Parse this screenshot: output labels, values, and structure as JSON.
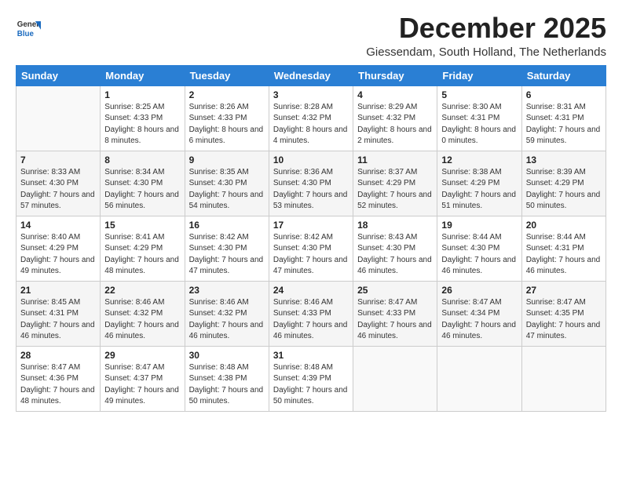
{
  "logo": {
    "general": "General",
    "blue": "Blue"
  },
  "title": "December 2025",
  "subtitle": "Giessendam, South Holland, The Netherlands",
  "header": {
    "days": [
      "Sunday",
      "Monday",
      "Tuesday",
      "Wednesday",
      "Thursday",
      "Friday",
      "Saturday"
    ]
  },
  "weeks": [
    [
      {
        "day": "",
        "info": ""
      },
      {
        "day": "1",
        "info": "Sunrise: 8:25 AM\nSunset: 4:33 PM\nDaylight: 8 hours\nand 8 minutes."
      },
      {
        "day": "2",
        "info": "Sunrise: 8:26 AM\nSunset: 4:33 PM\nDaylight: 8 hours\nand 6 minutes."
      },
      {
        "day": "3",
        "info": "Sunrise: 8:28 AM\nSunset: 4:32 PM\nDaylight: 8 hours\nand 4 minutes."
      },
      {
        "day": "4",
        "info": "Sunrise: 8:29 AM\nSunset: 4:32 PM\nDaylight: 8 hours\nand 2 minutes."
      },
      {
        "day": "5",
        "info": "Sunrise: 8:30 AM\nSunset: 4:31 PM\nDaylight: 8 hours\nand 0 minutes."
      },
      {
        "day": "6",
        "info": "Sunrise: 8:31 AM\nSunset: 4:31 PM\nDaylight: 7 hours\nand 59 minutes."
      }
    ],
    [
      {
        "day": "7",
        "info": "Sunrise: 8:33 AM\nSunset: 4:30 PM\nDaylight: 7 hours\nand 57 minutes."
      },
      {
        "day": "8",
        "info": "Sunrise: 8:34 AM\nSunset: 4:30 PM\nDaylight: 7 hours\nand 56 minutes."
      },
      {
        "day": "9",
        "info": "Sunrise: 8:35 AM\nSunset: 4:30 PM\nDaylight: 7 hours\nand 54 minutes."
      },
      {
        "day": "10",
        "info": "Sunrise: 8:36 AM\nSunset: 4:30 PM\nDaylight: 7 hours\nand 53 minutes."
      },
      {
        "day": "11",
        "info": "Sunrise: 8:37 AM\nSunset: 4:29 PM\nDaylight: 7 hours\nand 52 minutes."
      },
      {
        "day": "12",
        "info": "Sunrise: 8:38 AM\nSunset: 4:29 PM\nDaylight: 7 hours\nand 51 minutes."
      },
      {
        "day": "13",
        "info": "Sunrise: 8:39 AM\nSunset: 4:29 PM\nDaylight: 7 hours\nand 50 minutes."
      }
    ],
    [
      {
        "day": "14",
        "info": "Sunrise: 8:40 AM\nSunset: 4:29 PM\nDaylight: 7 hours\nand 49 minutes."
      },
      {
        "day": "15",
        "info": "Sunrise: 8:41 AM\nSunset: 4:29 PM\nDaylight: 7 hours\nand 48 minutes."
      },
      {
        "day": "16",
        "info": "Sunrise: 8:42 AM\nSunset: 4:30 PM\nDaylight: 7 hours\nand 47 minutes."
      },
      {
        "day": "17",
        "info": "Sunrise: 8:42 AM\nSunset: 4:30 PM\nDaylight: 7 hours\nand 47 minutes."
      },
      {
        "day": "18",
        "info": "Sunrise: 8:43 AM\nSunset: 4:30 PM\nDaylight: 7 hours\nand 46 minutes."
      },
      {
        "day": "19",
        "info": "Sunrise: 8:44 AM\nSunset: 4:30 PM\nDaylight: 7 hours\nand 46 minutes."
      },
      {
        "day": "20",
        "info": "Sunrise: 8:44 AM\nSunset: 4:31 PM\nDaylight: 7 hours\nand 46 minutes."
      }
    ],
    [
      {
        "day": "21",
        "info": "Sunrise: 8:45 AM\nSunset: 4:31 PM\nDaylight: 7 hours\nand 46 minutes."
      },
      {
        "day": "22",
        "info": "Sunrise: 8:46 AM\nSunset: 4:32 PM\nDaylight: 7 hours\nand 46 minutes."
      },
      {
        "day": "23",
        "info": "Sunrise: 8:46 AM\nSunset: 4:32 PM\nDaylight: 7 hours\nand 46 minutes."
      },
      {
        "day": "24",
        "info": "Sunrise: 8:46 AM\nSunset: 4:33 PM\nDaylight: 7 hours\nand 46 minutes."
      },
      {
        "day": "25",
        "info": "Sunrise: 8:47 AM\nSunset: 4:33 PM\nDaylight: 7 hours\nand 46 minutes."
      },
      {
        "day": "26",
        "info": "Sunrise: 8:47 AM\nSunset: 4:34 PM\nDaylight: 7 hours\nand 46 minutes."
      },
      {
        "day": "27",
        "info": "Sunrise: 8:47 AM\nSunset: 4:35 PM\nDaylight: 7 hours\nand 47 minutes."
      }
    ],
    [
      {
        "day": "28",
        "info": "Sunrise: 8:47 AM\nSunset: 4:36 PM\nDaylight: 7 hours\nand 48 minutes."
      },
      {
        "day": "29",
        "info": "Sunrise: 8:47 AM\nSunset: 4:37 PM\nDaylight: 7 hours\nand 49 minutes."
      },
      {
        "day": "30",
        "info": "Sunrise: 8:48 AM\nSunset: 4:38 PM\nDaylight: 7 hours\nand 50 minutes."
      },
      {
        "day": "31",
        "info": "Sunrise: 8:48 AM\nSunset: 4:39 PM\nDaylight: 7 hours\nand 50 minutes."
      },
      {
        "day": "",
        "info": ""
      },
      {
        "day": "",
        "info": ""
      },
      {
        "day": "",
        "info": ""
      }
    ]
  ]
}
